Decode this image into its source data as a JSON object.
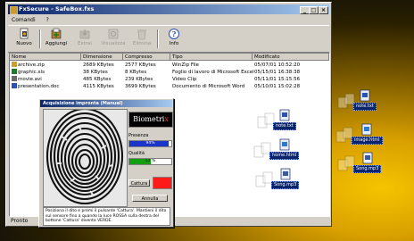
{
  "window": {
    "title": "FxSecure - SafeBox.fxs",
    "minimize_glyph": "_",
    "maximize_glyph": "□",
    "close_glyph": "×"
  },
  "menu": [
    "Comandi",
    "?"
  ],
  "toolbar": [
    {
      "label": "Nuovo",
      "icon": "new-icon",
      "enabled": true
    },
    {
      "label": "Aggiungi",
      "icon": "add-icon",
      "enabled": true
    },
    {
      "label": "Estrai",
      "icon": "extract-icon",
      "enabled": false
    },
    {
      "label": "Visualizza",
      "icon": "view-icon",
      "enabled": false
    },
    {
      "label": "Elimina",
      "icon": "delete-icon",
      "enabled": false
    },
    {
      "label": "Info",
      "icon": "info-icon",
      "enabled": true
    }
  ],
  "columns": [
    "Nome",
    "Dimensione",
    "Compresso",
    "Tipo",
    "Modificato"
  ],
  "files": [
    {
      "name": "archive.zip",
      "size": "2689 KBytes",
      "compressed": "2577 KBytes",
      "type": "WinZip File",
      "modified": "05/07/01 10:52:20",
      "icon_color": "#c8a030"
    },
    {
      "name": "graphic.xls",
      "size": "38 KBytes",
      "compressed": "8 KBytes",
      "type": "Foglio di lavoro di Microsoft Excel",
      "modified": "05/15/01 16:38:38",
      "icon_color": "#1f7a2a"
    },
    {
      "name": "movie.avi",
      "size": "485 KBytes",
      "compressed": "239 KBytes",
      "type": "Video Clip",
      "modified": "05/11/01 15:15:56",
      "icon_color": "#6b6b6b"
    },
    {
      "name": "presentation.doc",
      "size": "4115 KBytes",
      "compressed": "3699 KBytes",
      "type": "Documento di Microsoft Word",
      "modified": "05/10/01 15:02:28",
      "icon_color": "#2a52b0"
    }
  ],
  "statusbar": "Pronto",
  "dialog": {
    "title": "Acquisizione impronta (Manual)",
    "brand_main": "Biometri",
    "brand_accent": "x",
    "presence_label": "Presenza",
    "presence_value": "94%",
    "presence_fraction": 0.94,
    "quality_label": "Qualità",
    "quality_value": "51 %",
    "quality_fraction": 0.51,
    "capture_button": "Cattura",
    "cancel_button": "Annulla",
    "message": "Posiziona il dito e premi il pulsante 'Cattura'. Mantieni il dito sul sensore fino a quando la luce ROSSA sulla destra del bottone 'Cattura' diventa VERDE."
  },
  "desktop_icons": [
    {
      "caption": "note.txt",
      "icon": "text-file-icon"
    },
    {
      "caption": "image.html",
      "icon": "html-file-icon"
    },
    {
      "caption": "Song.mp3",
      "icon": "audio-file-icon"
    },
    {
      "caption": "note.txt",
      "icon": "text-file-icon"
    },
    {
      "caption": "home.html",
      "icon": "html-file-icon"
    },
    {
      "caption": "Song.mp3",
      "icon": "audio-file-icon"
    }
  ]
}
